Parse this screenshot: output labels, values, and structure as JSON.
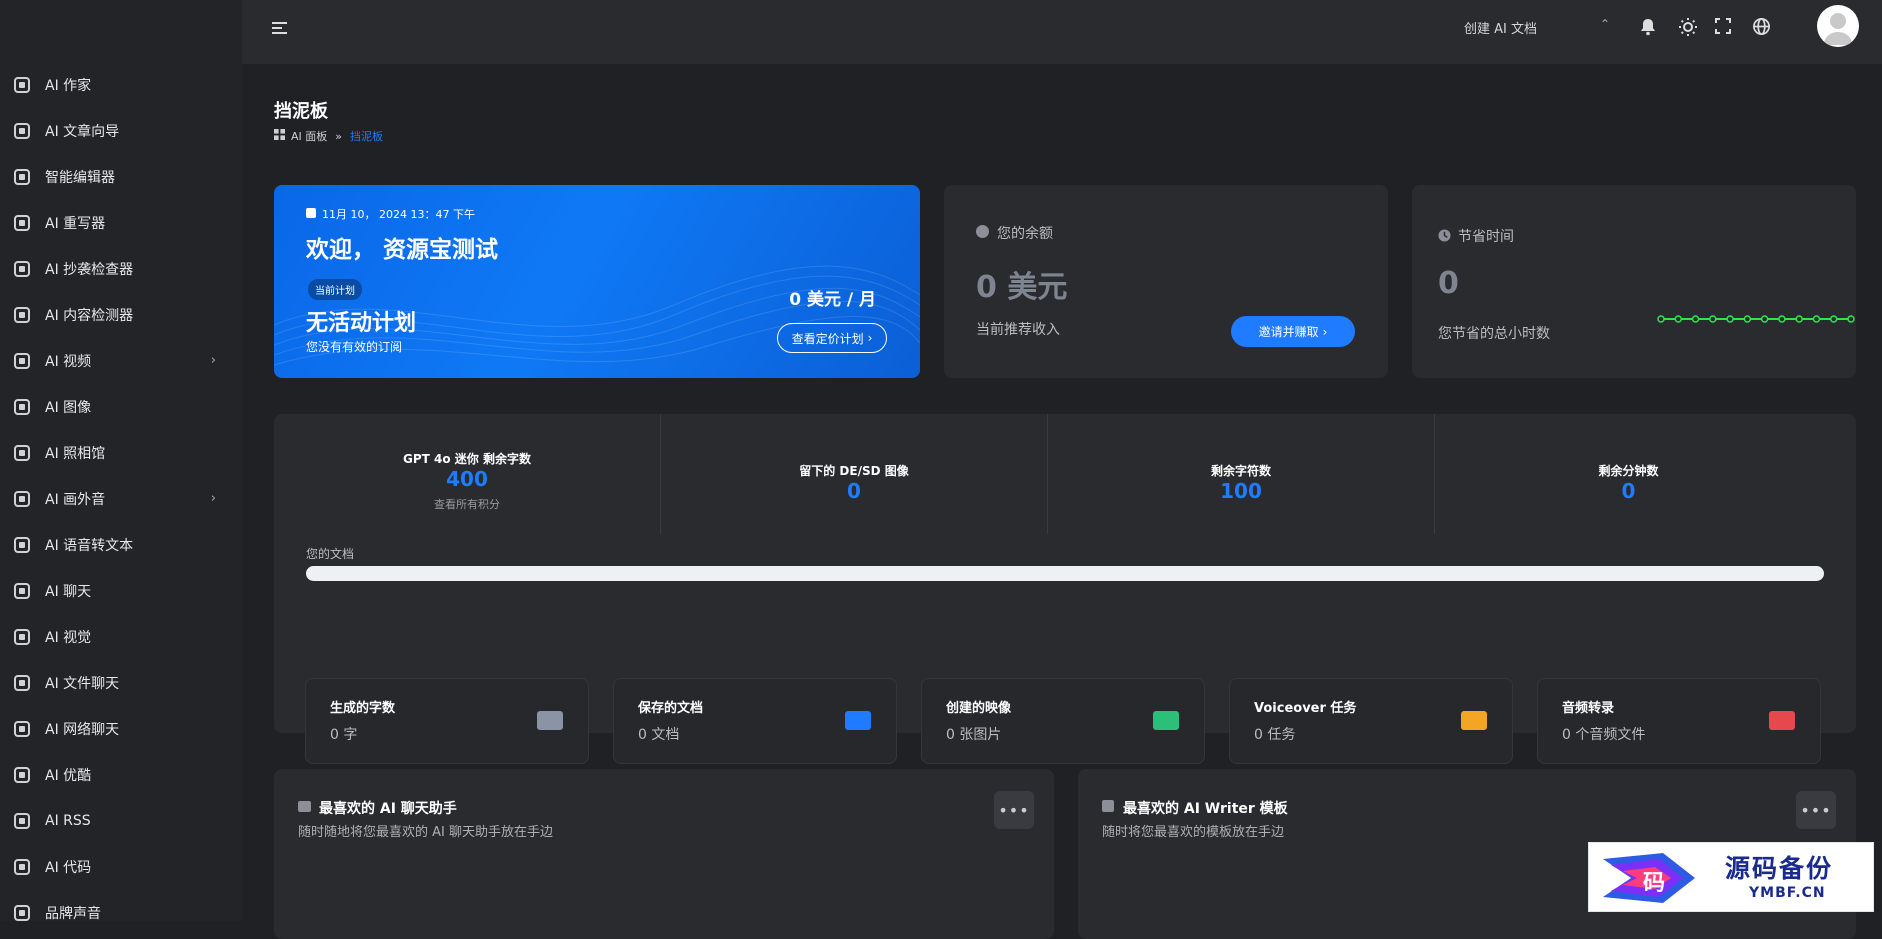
{
  "topbar": {
    "create_label": "创建 AI 文档",
    "colors": {
      "bg": "#2a2b2f",
      "accent": "#1f7bff"
    }
  },
  "sidebar": {
    "items": [
      {
        "label": "AI 作家",
        "icon": "chip-icon",
        "has_children": false
      },
      {
        "label": "AI 文章向导",
        "icon": "sparkle-icon",
        "has_children": false
      },
      {
        "label": "智能编辑器",
        "icon": "feather-icon",
        "has_children": false
      },
      {
        "label": "AI 重写器",
        "icon": "pen-icon",
        "has_children": false
      },
      {
        "label": "AI 抄袭检查器",
        "icon": "shield-icon",
        "has_children": false
      },
      {
        "label": "AI 内容检测器",
        "icon": "user-secret-icon",
        "has_children": false
      },
      {
        "label": "AI 视频",
        "icon": "video-icon",
        "has_children": true
      },
      {
        "label": "AI 图像",
        "icon": "image-frame-icon",
        "has_children": false
      },
      {
        "label": "AI 照相馆",
        "icon": "photo-icon",
        "has_children": false
      },
      {
        "label": "AI 画外音",
        "icon": "waveform-icon",
        "has_children": true
      },
      {
        "label": "AI 语音转文本",
        "icon": "audio-file-icon",
        "has_children": false
      },
      {
        "label": "AI 聊天",
        "icon": "chat-icon",
        "has_children": false
      },
      {
        "label": "AI 视觉",
        "icon": "vision-icon",
        "has_children": false
      },
      {
        "label": "AI 文件聊天",
        "icon": "folder-chat-icon",
        "has_children": false
      },
      {
        "label": "AI 网络聊天",
        "icon": "globe-icon",
        "has_children": false
      },
      {
        "label": "AI 优酷",
        "icon": "youtube-icon",
        "has_children": false
      },
      {
        "label": "AI RSS",
        "icon": "rss-icon",
        "has_children": false
      },
      {
        "label": "AI 代码",
        "icon": "code-icon",
        "has_children": false
      },
      {
        "label": "品牌声音",
        "icon": "brand-voice-icon",
        "has_children": false
      }
    ]
  },
  "page": {
    "title": "挡泥板",
    "breadcrumb": {
      "root": "AI 面板",
      "sep": "»",
      "current": "挡泥板"
    }
  },
  "welcome": {
    "date": "11月 10， 2024 13：47 下午",
    "greeting": "欢迎， 资源宝测试",
    "plan_badge": "当前计划",
    "plan_name": "无活动计划",
    "plan_note": "您没有有效的订阅",
    "price": "0 美元 / 月",
    "pricing_button": "查看定价计划"
  },
  "balance": {
    "label": "您的余额",
    "amount": "0 美元",
    "note": "当前推荐收入",
    "button": "邀请并赚取"
  },
  "time_saved": {
    "label": "节省时间",
    "value": "0",
    "note": "您节省的总小时数",
    "sparkline": [
      0,
      0,
      0,
      0,
      0,
      0,
      0,
      0,
      0,
      0,
      0,
      0
    ]
  },
  "stats": [
    {
      "label": "GPT 4o 迷你 剩余字数",
      "value": "400",
      "sub": "查看所有积分"
    },
    {
      "label": "留下的 DE/SD 图像",
      "value": "0",
      "sub": ""
    },
    {
      "label": "剩余字符数",
      "value": "100",
      "sub": ""
    },
    {
      "label": "剩余分钟数",
      "value": "0",
      "sub": ""
    }
  ],
  "documents": {
    "label": "您的文档",
    "progress": 0
  },
  "tiles": [
    {
      "title": "生成的字数",
      "value": "0 字",
      "icon": "chip-icon",
      "color": "#8a94a6"
    },
    {
      "title": "保存的文档",
      "value": "0 文档",
      "icon": "folder-icon",
      "color": "#1f7bff"
    },
    {
      "title": "创建的映像",
      "value": "0 张图片",
      "icon": "image-icon",
      "color": "#2bbf7a"
    },
    {
      "title": "Voiceover 任务",
      "value": "0 任务",
      "icon": "waveform-icon",
      "color": "#f5a524"
    },
    {
      "title": "音频转录",
      "value": "0 个音频文件",
      "icon": "music-file-icon",
      "color": "#e5484d"
    }
  ],
  "favorites": [
    {
      "title": "最喜欢的 AI 聊天助手",
      "subtitle": "随时随地将您最喜欢的 AI 聊天助手放在手边",
      "icon": "chat-icon"
    },
    {
      "title": "最喜欢的 AI Writer 模板",
      "subtitle": "随时将您最喜欢的模板放在手边",
      "icon": "chip-icon"
    }
  ],
  "watermark": {
    "line1": "源码备份",
    "line2": "YMBF.CN",
    "glyph": "码"
  }
}
